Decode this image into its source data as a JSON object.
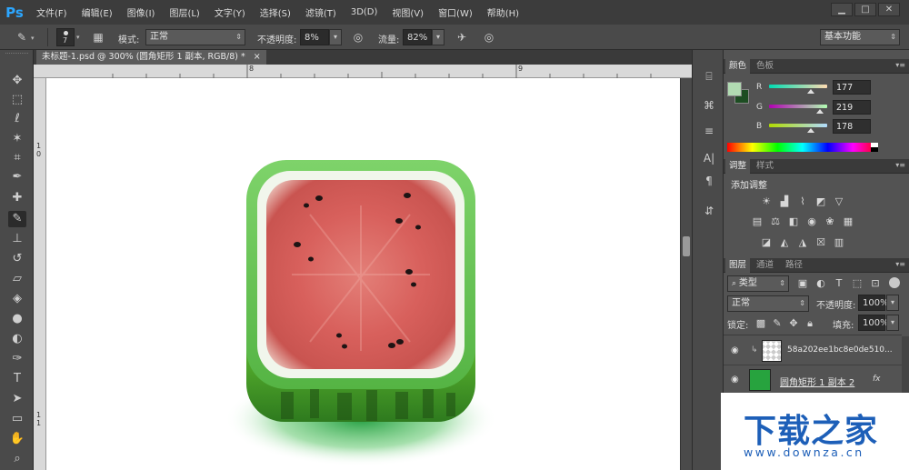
{
  "app": {
    "logo": "Ps"
  },
  "menu": [
    "文件(F)",
    "编辑(E)",
    "图像(I)",
    "图层(L)",
    "文字(Y)",
    "选择(S)",
    "滤镜(T)",
    "3D(D)",
    "视图(V)",
    "窗口(W)",
    "帮助(H)"
  ],
  "window_controls": {
    "minimize": "▁",
    "restore": "□",
    "close": "✕"
  },
  "options": {
    "brush_size": "7",
    "mode_label": "模式:",
    "mode_value": "正常",
    "opacity_label": "不透明度:",
    "opacity_value": "8%",
    "flow_label": "流量:",
    "flow_value": "82%",
    "workspace": "基本功能"
  },
  "document": {
    "tab_title": "未标题-1.psd @ 300% (圆角矩形 1 副本, RGB/8) *",
    "close": "×",
    "ruler_top": [
      "8",
      "9"
    ],
    "ruler_left": [
      "1",
      "0",
      "1",
      "1"
    ]
  },
  "color_panel": {
    "tabs": [
      "颜色",
      "色板"
    ],
    "channels": [
      {
        "name": "R",
        "value": "177"
      },
      {
        "name": "G",
        "value": "219"
      },
      {
        "name": "B",
        "value": "178"
      }
    ],
    "foreground": "#b1dbb2",
    "background": "#1d4d22"
  },
  "adjust_panel": {
    "tabs": [
      "调整",
      "样式"
    ],
    "heading": "添加调整"
  },
  "layers_panel": {
    "tabs": [
      "图层",
      "通道",
      "路径"
    ],
    "filter": "类型",
    "blend_mode": "正常",
    "opacity_label": "不透明度:",
    "opacity_value": "100%",
    "lock_label": "锁定:",
    "fill_label": "填充:",
    "fill_value": "100%",
    "layers": [
      {
        "name": "58a202ee1bc8e0de510...",
        "fx": ""
      },
      {
        "name": "圆角矩形 1 副本 2",
        "fx": "fx"
      }
    ]
  },
  "watermark": {
    "logo": "下载之家",
    "url": "www.downza.cn"
  }
}
